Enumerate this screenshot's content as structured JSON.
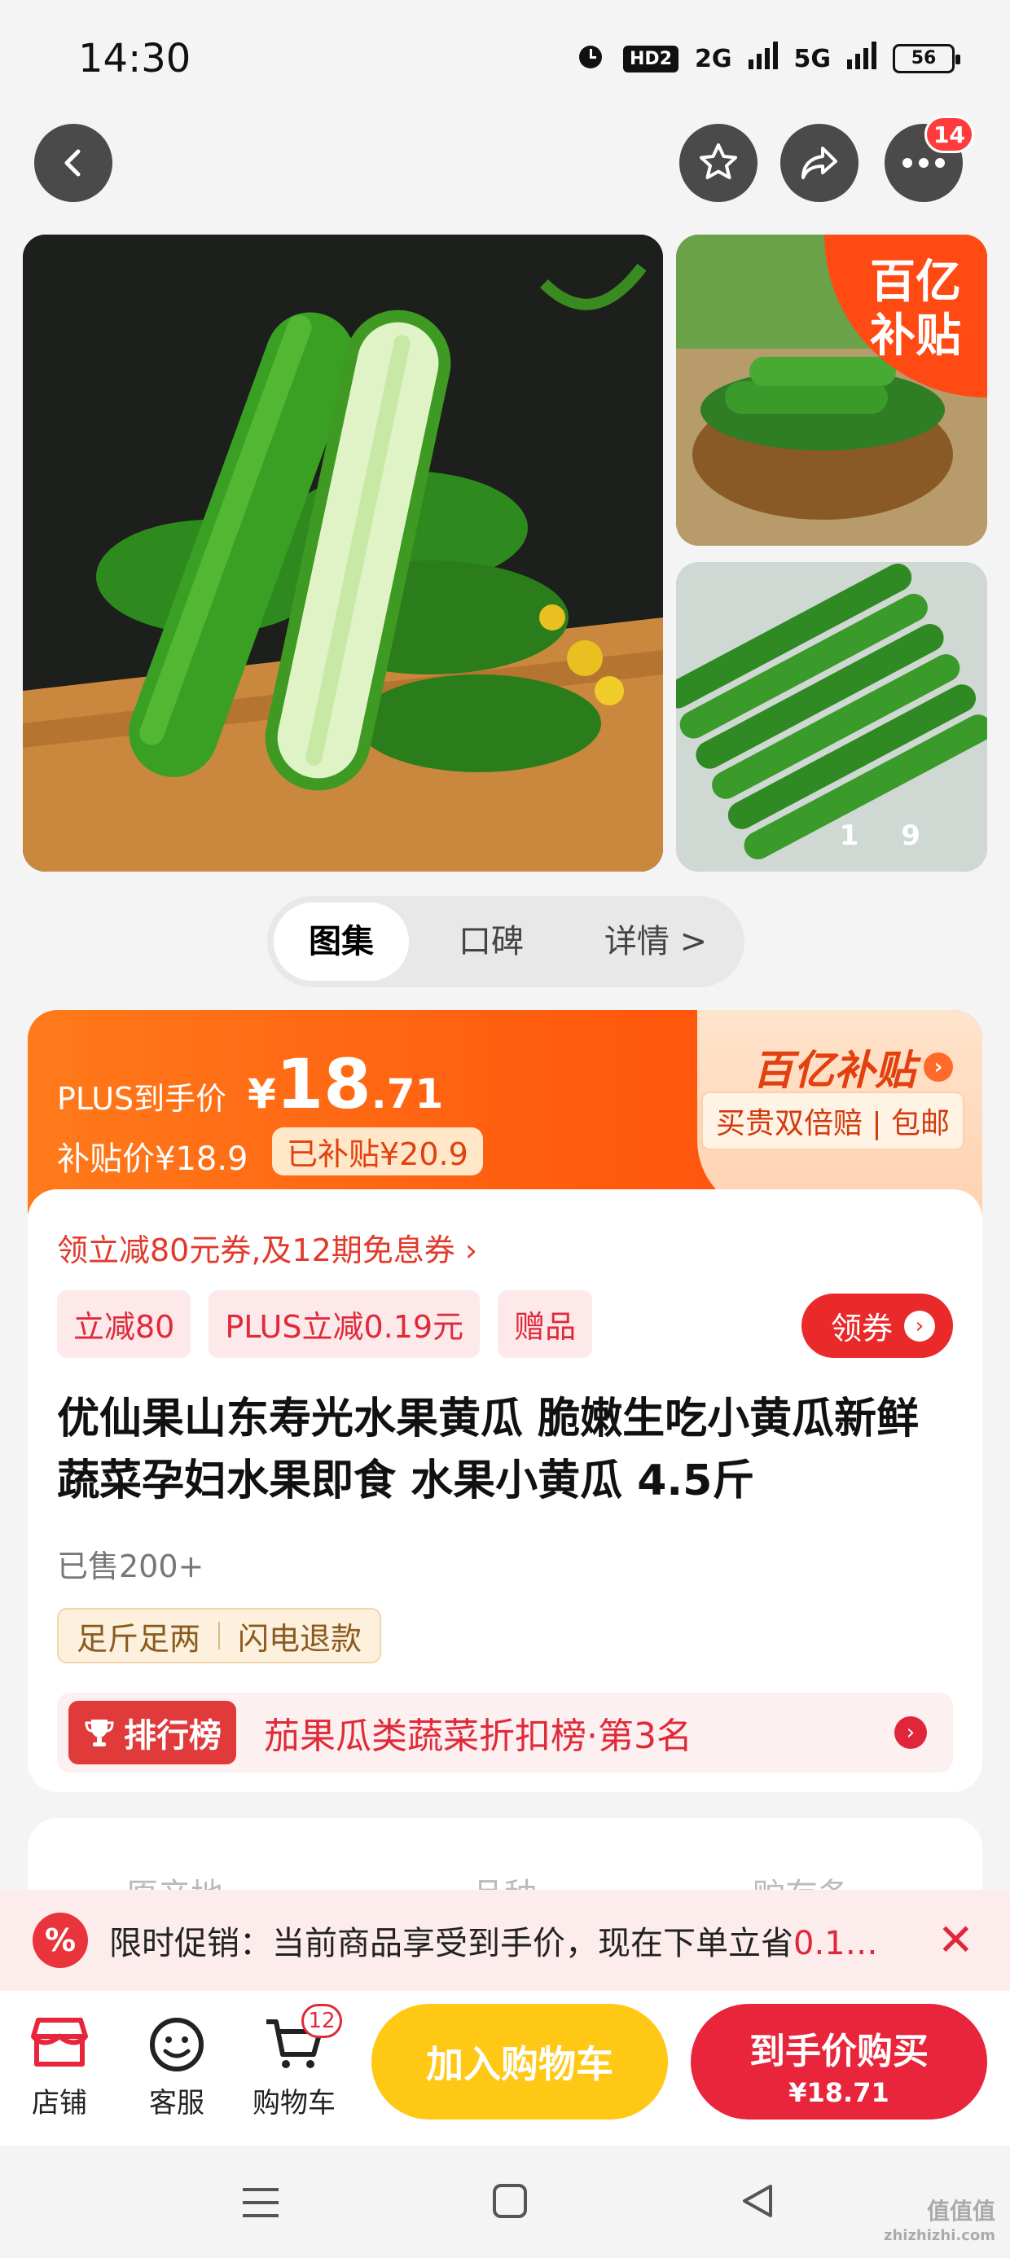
{
  "status_bar": {
    "time": "14:30",
    "hd": "HD2",
    "net1": "2G",
    "net2": "5G",
    "battery": "56"
  },
  "top_nav": {
    "cart_count": "14"
  },
  "gallery": {
    "billion_tag_l1": "百亿",
    "billion_tag_l2": "补贴",
    "counter_current": "1",
    "counter_total": "9"
  },
  "segment_tabs": {
    "gallery": "图集",
    "reviews": "口碑",
    "details": "详情 >"
  },
  "price": {
    "plus_label": "PLUS到手价",
    "currency": "¥",
    "int": "18",
    "dec": ".71",
    "subsidy_price": "补贴价¥18.9",
    "subsidy_chip": "已补贴¥20.9",
    "billion_head": "百亿补贴",
    "billion_arrow": "›",
    "guarantee": "买贵双倍赔 | 包邮"
  },
  "coupon": {
    "line": "领立减80元券,及12期免息券 ›",
    "tags": [
      "立减80",
      "PLUS立减0.19元",
      "赠品"
    ],
    "claim": "领券",
    "claim_arrow": "›"
  },
  "product": {
    "title": "优仙果山东寿光水果黄瓜 脆嫩生吃小黄瓜新鲜蔬菜孕妇水果即食 水果小黄瓜 4.5斤",
    "sold": "已售200+",
    "service_1": "足斤足两",
    "service_2": "闪电退款"
  },
  "rank": {
    "badge": "排行榜",
    "text": "茄果瓜类蔬菜折扣榜·第3名",
    "arrow": "›"
  },
  "next_card": {
    "col1": "原产地",
    "col2": "品种",
    "col3": "贮存条"
  },
  "promo": {
    "icon": "%",
    "text": "限时促销：当前商品享受到手价，现在下单立省",
    "highlight": "0.1…",
    "close": "✕"
  },
  "bottom_bar": {
    "store": "店铺",
    "service": "客服",
    "cart": "购物车",
    "cart_count": "12",
    "add_to_cart": "加入购物车",
    "buy_now": "到手价购买",
    "buy_price": "¥18.71"
  },
  "watermark": {
    "l1": "值值值",
    "l2": "zhizhizhi.com"
  },
  "colors": {
    "accent_orange": "#ff5a0e",
    "accent_red": "#e8253a",
    "cart_yellow": "#ffc815"
  }
}
